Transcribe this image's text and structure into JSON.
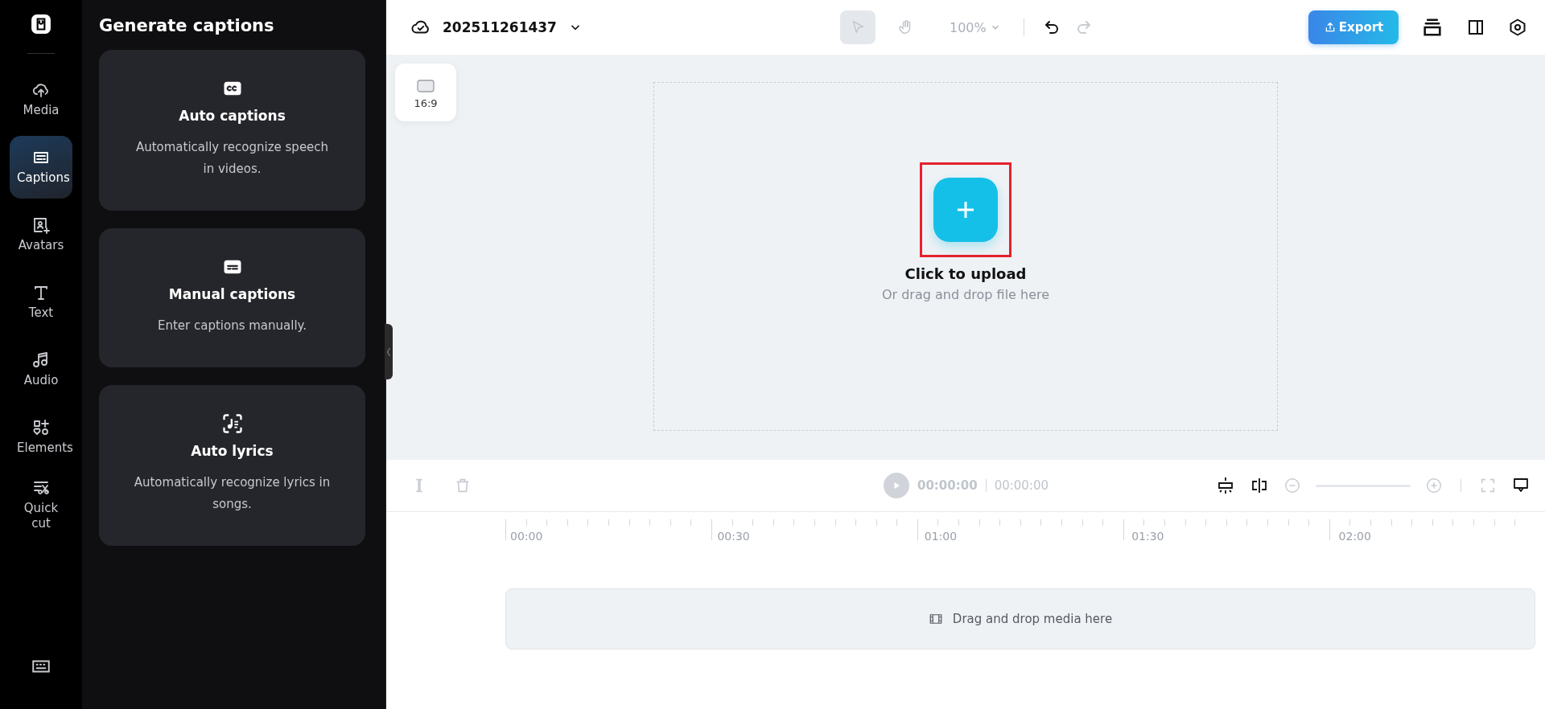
{
  "nav": {
    "items": [
      {
        "kind": "media",
        "label": "Media",
        "selected": false
      },
      {
        "kind": "captions",
        "label": "Captions",
        "selected": true
      },
      {
        "kind": "avatars",
        "label": "Avatars",
        "selected": false
      },
      {
        "kind": "text",
        "label": "Text",
        "selected": false
      },
      {
        "kind": "audio",
        "label": "Audio",
        "selected": false
      },
      {
        "kind": "elements",
        "label": "Elements",
        "selected": false
      },
      {
        "kind": "quickcut",
        "label": "Quick cut",
        "selected": false
      }
    ]
  },
  "panel": {
    "title": "Generate captions",
    "cards": [
      {
        "kind": "cc",
        "title": "Auto captions",
        "description": "Automatically recognize speech in videos."
      },
      {
        "kind": "subtitle",
        "title": "Manual captions",
        "description": "Enter captions manually."
      },
      {
        "kind": "lyrics",
        "title": "Auto lyrics",
        "description": "Automatically recognize lyrics in songs."
      }
    ]
  },
  "topbar": {
    "project_name": "202511261437",
    "tools": [
      {
        "kind": "select",
        "selected": true,
        "disabled": true
      },
      {
        "kind": "hand",
        "selected": false,
        "disabled": true
      }
    ],
    "zoom": "100%",
    "zoom_disabled": true,
    "undo_disabled": false,
    "redo_disabled": true,
    "export_label": "Export"
  },
  "canvas": {
    "aspect_ratio": "16:9",
    "upload_title": "Click to upload",
    "upload_hint": "Or drag and drop file here",
    "highlighted": true
  },
  "timeline": {
    "controls_disabled": true,
    "current_time": "00:00:00",
    "total_time": "00:00:00",
    "ticks": [
      "00:00",
      "00:30",
      "01:00",
      "01:30",
      "02:00"
    ],
    "drop_hint": "Drag and drop media here"
  }
}
